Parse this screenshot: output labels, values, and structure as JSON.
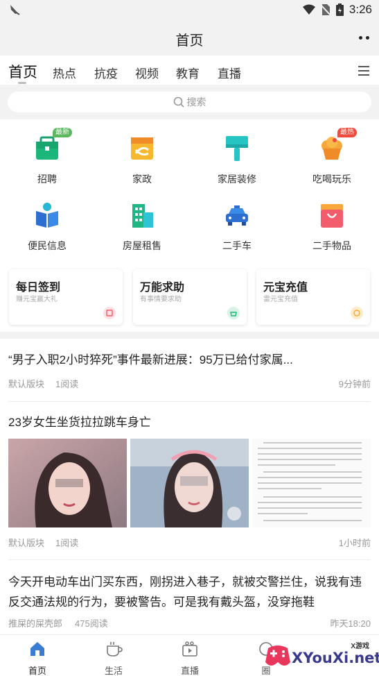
{
  "status_bar": {
    "time": "3:26"
  },
  "header": {
    "title": "首页"
  },
  "tabs": [
    {
      "label": "首页",
      "active": true
    },
    {
      "label": "热点"
    },
    {
      "label": "抗疫"
    },
    {
      "label": "视频"
    },
    {
      "label": "教育"
    },
    {
      "label": "直播"
    }
  ],
  "search": {
    "placeholder": "搜索"
  },
  "grid": [
    {
      "label": "招聘",
      "icon": "briefcase-icon",
      "badge": "最新",
      "badge_color": "#5cb85c"
    },
    {
      "label": "家政",
      "icon": "housekeeping-icon"
    },
    {
      "label": "家居装修",
      "icon": "paint-roller-icon"
    },
    {
      "label": "吃喝玩乐",
      "icon": "cake-icon",
      "badge": "最热",
      "badge_color": "#f04b3c"
    },
    {
      "label": "便民信息",
      "icon": "book-icon"
    },
    {
      "label": "房屋租售",
      "icon": "building-icon"
    },
    {
      "label": "二手车",
      "icon": "car-icon"
    },
    {
      "label": "二手物品",
      "icon": "shopping-bag-icon"
    }
  ],
  "cards": [
    {
      "title": "每日签到",
      "subtitle": "赚元宝赢大礼",
      "icon": "calendar-icon"
    },
    {
      "title": "万能求助",
      "subtitle": "有事情要求助",
      "icon": "help-icon"
    },
    {
      "title": "元宝充值",
      "subtitle": "雷元宝充值",
      "icon": "coin-icon"
    }
  ],
  "news": [
    {
      "title": "“男子入职2小时猝死”事件最新进展：95万已给付家属...",
      "source": "默认版块",
      "reads": "1阅读",
      "time": "9分钟前"
    },
    {
      "title": "23岁女生坐货拉拉跳车身亡",
      "source": "默认版块",
      "reads": "1阅读",
      "time": "1小时前"
    },
    {
      "title": "今天开电动车出门买东西，刚拐进入巷子，就被交警拦住，说我有违反交通法规的行为，要被警告。可是我有戴头盔，没穿拖鞋",
      "source": "推屎的屎壳郎",
      "reads": "475阅读",
      "time": "昨天18:20"
    }
  ],
  "bottom_nav": [
    {
      "label": "首页",
      "icon": "home-icon",
      "active": true
    },
    {
      "label": "生活",
      "icon": "coffee-icon"
    },
    {
      "label": "直播",
      "icon": "video-icon"
    },
    {
      "label": "圈",
      "icon": "circle-icon"
    }
  ],
  "watermark": {
    "text": "XYouXi.net",
    "small": "X游戏"
  },
  "colors": {
    "accent": "#3a7bd5",
    "badge_new": "#5cb85c",
    "badge_hot": "#f04b3c"
  }
}
